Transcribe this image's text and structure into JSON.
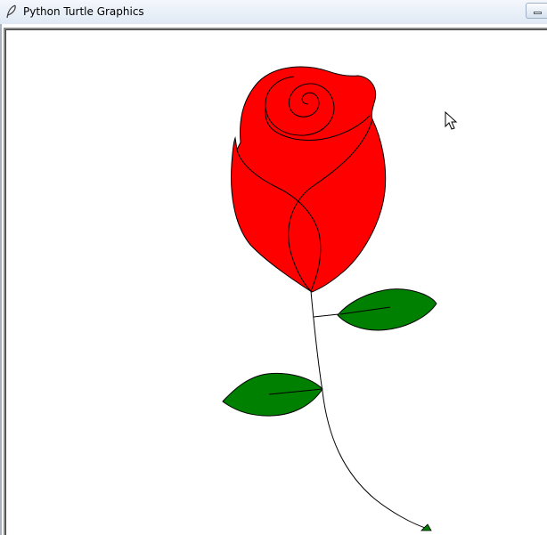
{
  "window": {
    "title": "Python Turtle Graphics",
    "title_icon": "feather-icon",
    "minimize_icon": "minimize-icon"
  },
  "canvas": {
    "background": "#ffffff",
    "drawing": {
      "petal_color": "#ff0000",
      "leaf_color": "#008000",
      "stroke_color": "#000000",
      "turtle_color": "#008000"
    },
    "cursor_icon": "mouse-pointer-icon",
    "turtle_icon": "turtle-arrow-icon"
  }
}
